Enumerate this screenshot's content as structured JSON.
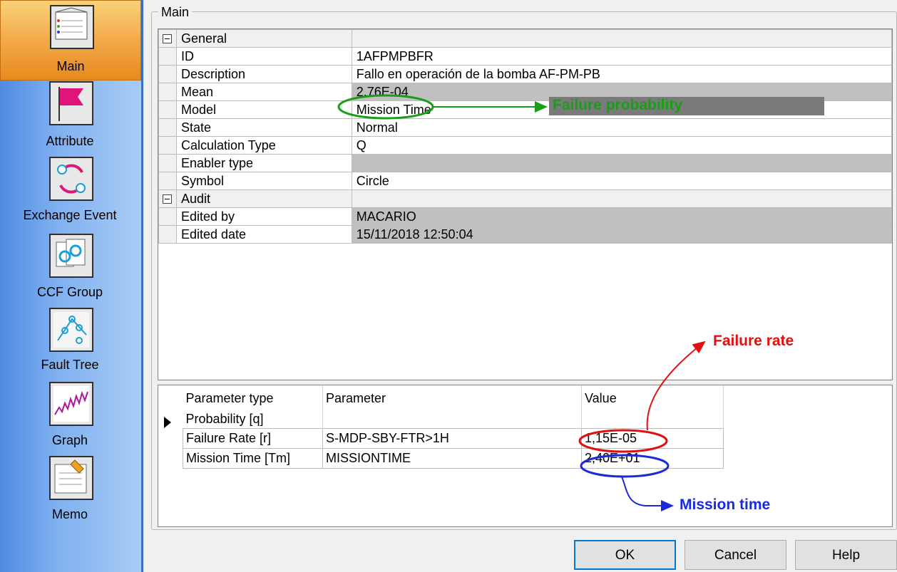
{
  "sidebar": {
    "items": [
      {
        "label": "Main",
        "icon": "notebook-icon",
        "selected": true
      },
      {
        "label": "Attribute",
        "icon": "flag-icon"
      },
      {
        "label": "Exchange Event",
        "icon": "exchange-cycle-icon"
      },
      {
        "label": "CCF Group",
        "icon": "ccf-group-icon"
      },
      {
        "label": "Fault Tree",
        "icon": "fault-tree-icon"
      },
      {
        "label": "Graph",
        "icon": "graph-icon"
      },
      {
        "label": "Memo",
        "icon": "memo-icon"
      }
    ]
  },
  "main": {
    "group_title": "Main",
    "properties": [
      {
        "type": "category",
        "name": "General",
        "value": ""
      },
      {
        "type": "row",
        "name": "ID",
        "value": "1AFPMPBFR"
      },
      {
        "type": "row",
        "name": "Description",
        "value": "Fallo en operación de la bomba AF-PM-PB"
      },
      {
        "type": "row",
        "name": "Mean",
        "value": "2,76E-04",
        "readonly": true
      },
      {
        "type": "row",
        "name": "Model",
        "value": "Mission Time"
      },
      {
        "type": "row",
        "name": "State",
        "value": "Normal"
      },
      {
        "type": "row",
        "name": "Calculation Type",
        "value": "Q"
      },
      {
        "type": "row",
        "name": "Enabler type",
        "value": "",
        "readonly": true
      },
      {
        "type": "row",
        "name": "Symbol",
        "value": "Circle"
      },
      {
        "type": "category",
        "name": "Audit",
        "value": ""
      },
      {
        "type": "row",
        "name": "Edited by",
        "value": "MACARIO",
        "readonly": true
      },
      {
        "type": "row",
        "name": "Edited date",
        "value": "15/11/2018 12:50:04",
        "readonly": true
      }
    ],
    "parameters": {
      "headers": [
        "Parameter type",
        "Parameter",
        "Value"
      ],
      "subheader": "Probability [q]",
      "rows": [
        {
          "type": "Failure Rate [r]",
          "parameter": "S-MDP-SBY-FTR>1H",
          "value": "1,15E-05"
        },
        {
          "type": "Mission Time [Tm]",
          "parameter": "MISSIONTIME",
          "value": "2,40E+01"
        }
      ]
    }
  },
  "buttons": {
    "ok": "OK",
    "cancel": "Cancel",
    "help": "Help"
  },
  "annotations": {
    "failure_probability": "Failure probability",
    "failure_rate": "Failure rate",
    "mission_time": "Mission time",
    "colors": {
      "green": "#1a9e1a",
      "red": "#e01010",
      "blue": "#1a2ad8"
    }
  }
}
